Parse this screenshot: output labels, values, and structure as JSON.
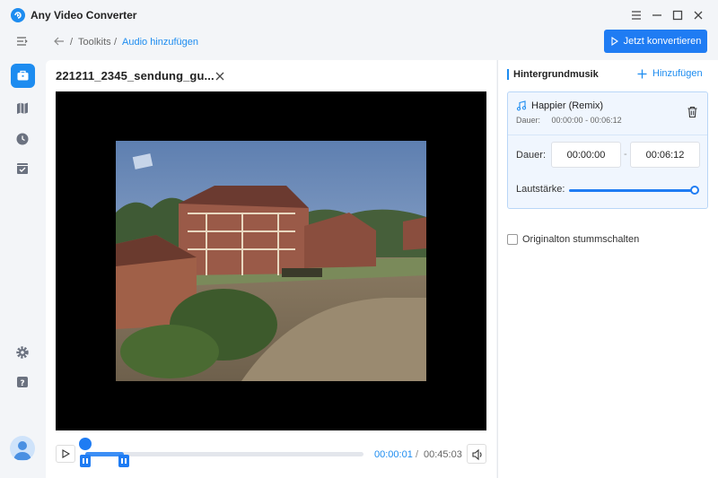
{
  "app": {
    "title": "Any Video Converter"
  },
  "toolbar": {
    "crumbs": [
      "Toolkits",
      "Audio hinzufügen"
    ],
    "separator": "/",
    "convert_label": "Jetzt konvertieren"
  },
  "sidebar": {
    "items": [
      {
        "name": "toolkit",
        "icon": "briefcase-icon",
        "active": true
      },
      {
        "name": "library",
        "icon": "map-icon",
        "active": false
      },
      {
        "name": "history",
        "icon": "clock-icon",
        "active": false
      },
      {
        "name": "tasks",
        "icon": "checklist-icon",
        "active": false
      }
    ],
    "bottom": [
      "gear-icon",
      "help-icon",
      "avatar"
    ]
  },
  "video": {
    "title": "221211_2345_sendung_gu...",
    "watermark": "ndr 888"
  },
  "playback": {
    "current": "00:00:01",
    "separator": "/",
    "total": "00:45:03",
    "progress_fraction": 0.0
  },
  "music": {
    "header": "Hintergrundmusik",
    "add_label": "Hinzufügen",
    "track": {
      "name": "Happier (Remix)",
      "duration_label": "Dauer:",
      "duration_range": "00:00:00 - 00:06:12"
    },
    "dauer_label": "Dauer:",
    "start_time": "00:00:00",
    "end_time": "00:06:12",
    "dash": "-",
    "volume_label": "Lautstärke:",
    "volume_fraction": 1.0,
    "mute_label": "Originalton stummschalten",
    "mute_checked": false
  },
  "colors": {
    "accent": "#1f7cf3",
    "accent_light": "#f0f6fe"
  }
}
